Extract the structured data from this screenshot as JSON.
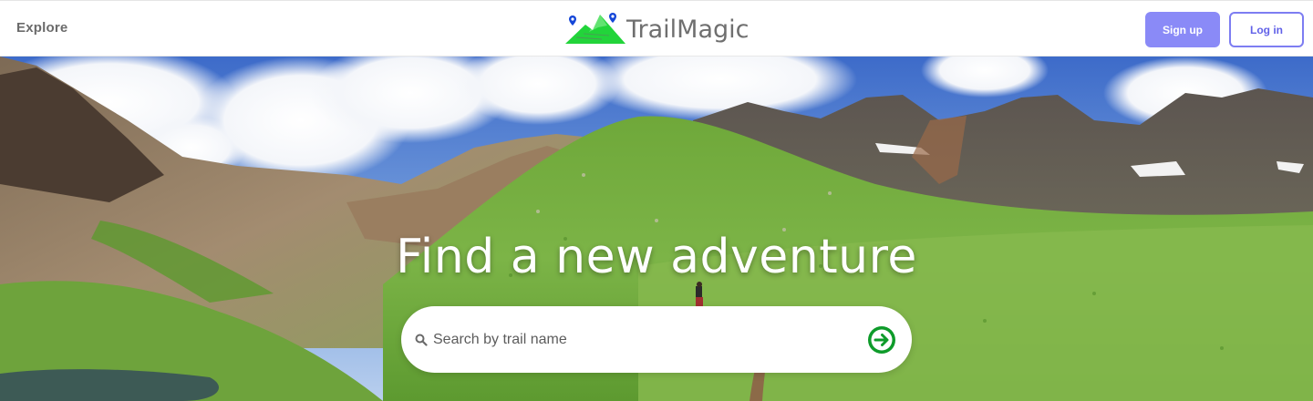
{
  "header": {
    "explore_label": "Explore",
    "brand_name": "TrailMagic",
    "signup_label": "Sign up",
    "login_label": "Log in"
  },
  "hero": {
    "title": "Find a new adventure",
    "search": {
      "placeholder": "Search by trail name",
      "value": "",
      "submit_icon": "arrow-right-circle-icon",
      "search_icon": "search-icon"
    }
  },
  "colors": {
    "signup_bg": "#8a8af7",
    "login_border": "#7d7df2",
    "submit_green": "#0e9b2a",
    "brand_text": "#6f6f6f",
    "logo_green": "#22d43a",
    "logo_pin_blue": "#1446d8"
  }
}
